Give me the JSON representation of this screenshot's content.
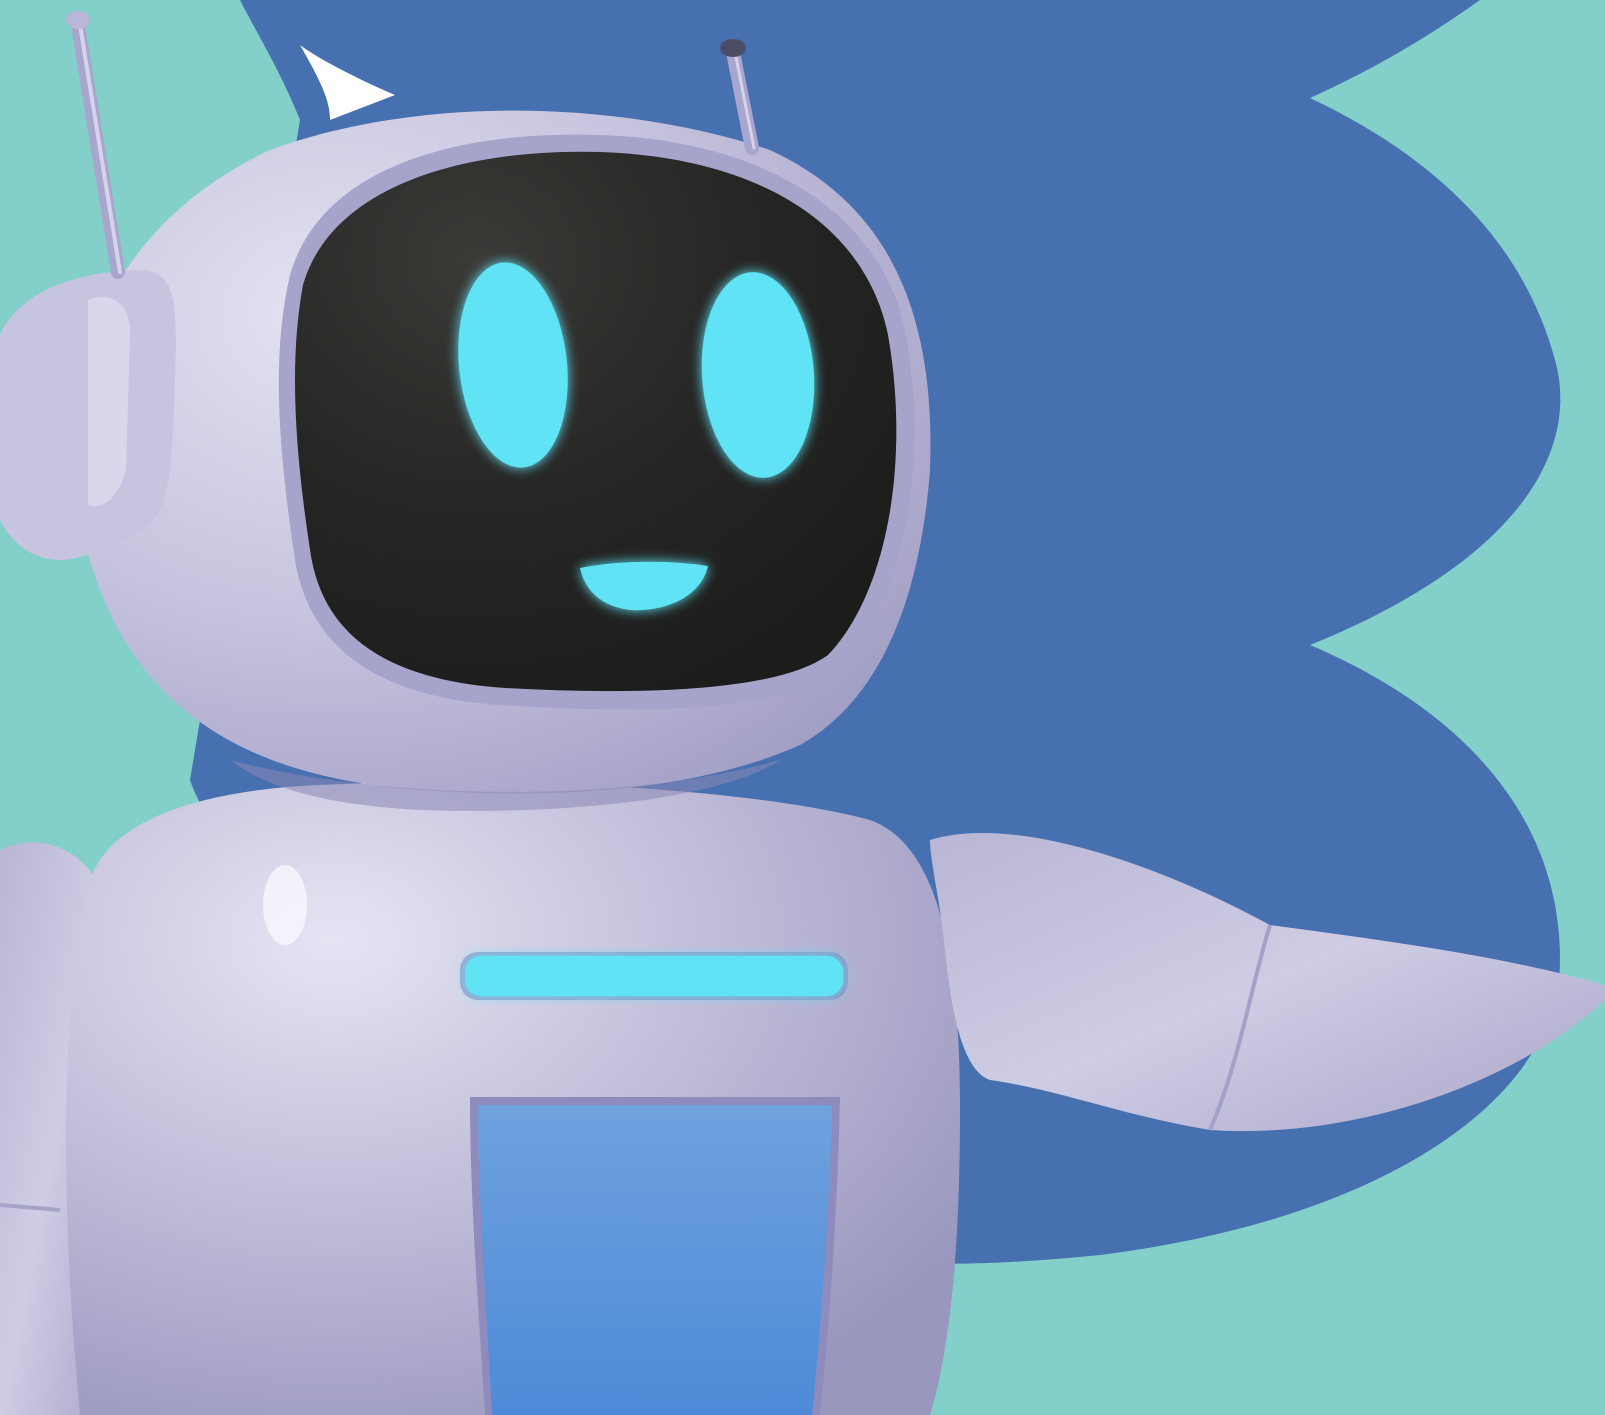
{
  "scene": {
    "subject": "robot-mascot",
    "pose": "pointing-right",
    "colors": {
      "background": "#82d0c9",
      "blob": "#4670b0",
      "body": "#c4c1dc",
      "body_shadow": "#9f9cc2",
      "body_highlight": "#e2e0f0",
      "visor": "#262624",
      "glow": "#5ee3f5",
      "chest_panel": "#5693dc"
    },
    "icons": [
      "robot-antenna-icon",
      "robot-eye-icon",
      "robot-smile-icon",
      "chest-light-icon"
    ]
  }
}
